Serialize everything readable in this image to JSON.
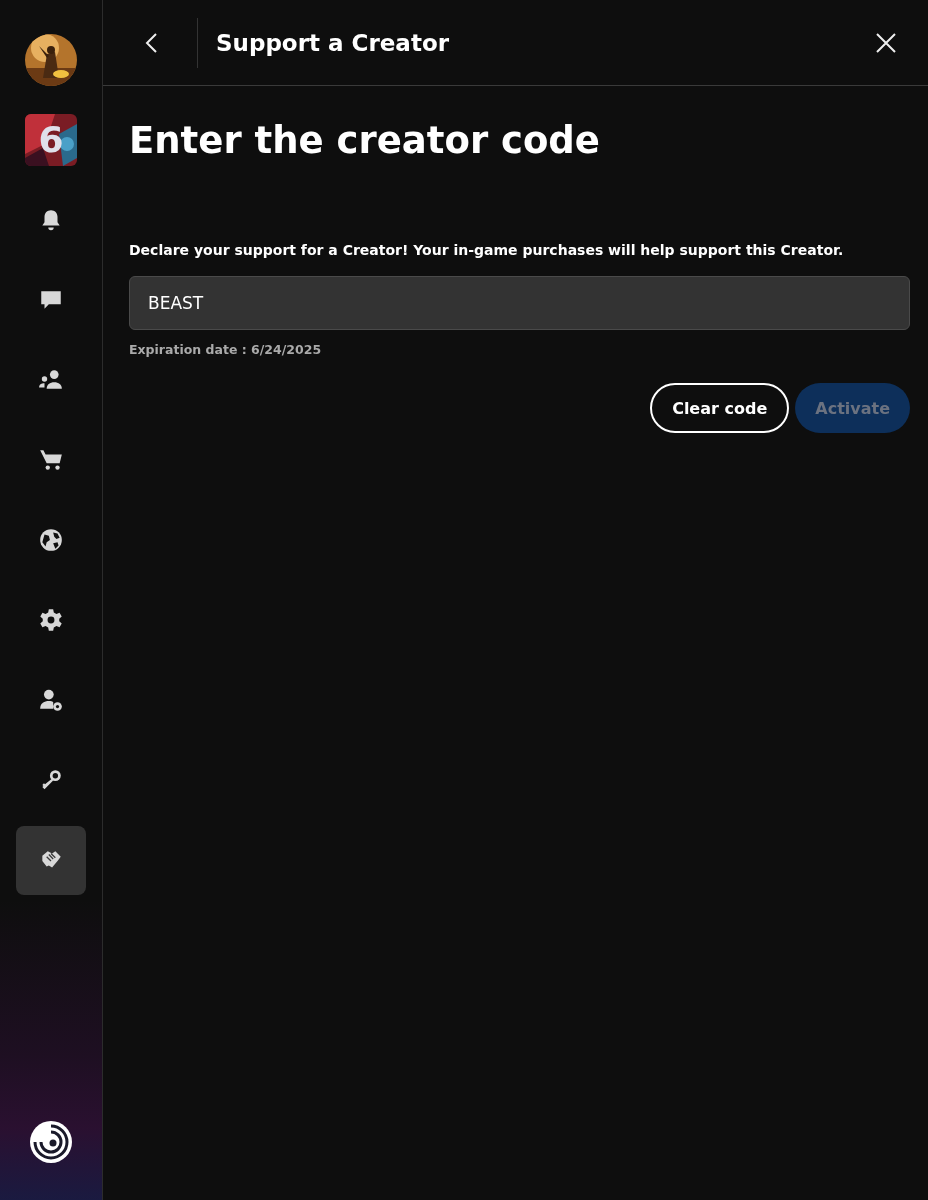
{
  "sidebar": {
    "game": {
      "logo_text": "6"
    },
    "items": [
      {
        "kind": "bell",
        "selected": false
      },
      {
        "kind": "chat",
        "selected": false
      },
      {
        "kind": "friends",
        "selected": false
      },
      {
        "kind": "cart",
        "selected": false
      },
      {
        "kind": "globe",
        "selected": false
      },
      {
        "kind": "gear",
        "selected": false
      },
      {
        "kind": "account",
        "selected": false
      },
      {
        "kind": "key",
        "selected": false
      },
      {
        "kind": "handshake",
        "selected": true
      }
    ]
  },
  "header": {
    "title": "Support a Creator"
  },
  "heading": "Enter the creator code",
  "description": "Declare your support for a Creator! Your in-game purchases will help support this Creator.",
  "code_field": {
    "value": "BEAST"
  },
  "expiration": "Expiration date : 6/24/2025",
  "buttons": [
    {
      "label": "Clear code",
      "disabled": false
    },
    {
      "label": "Activate",
      "disabled": true
    }
  ]
}
